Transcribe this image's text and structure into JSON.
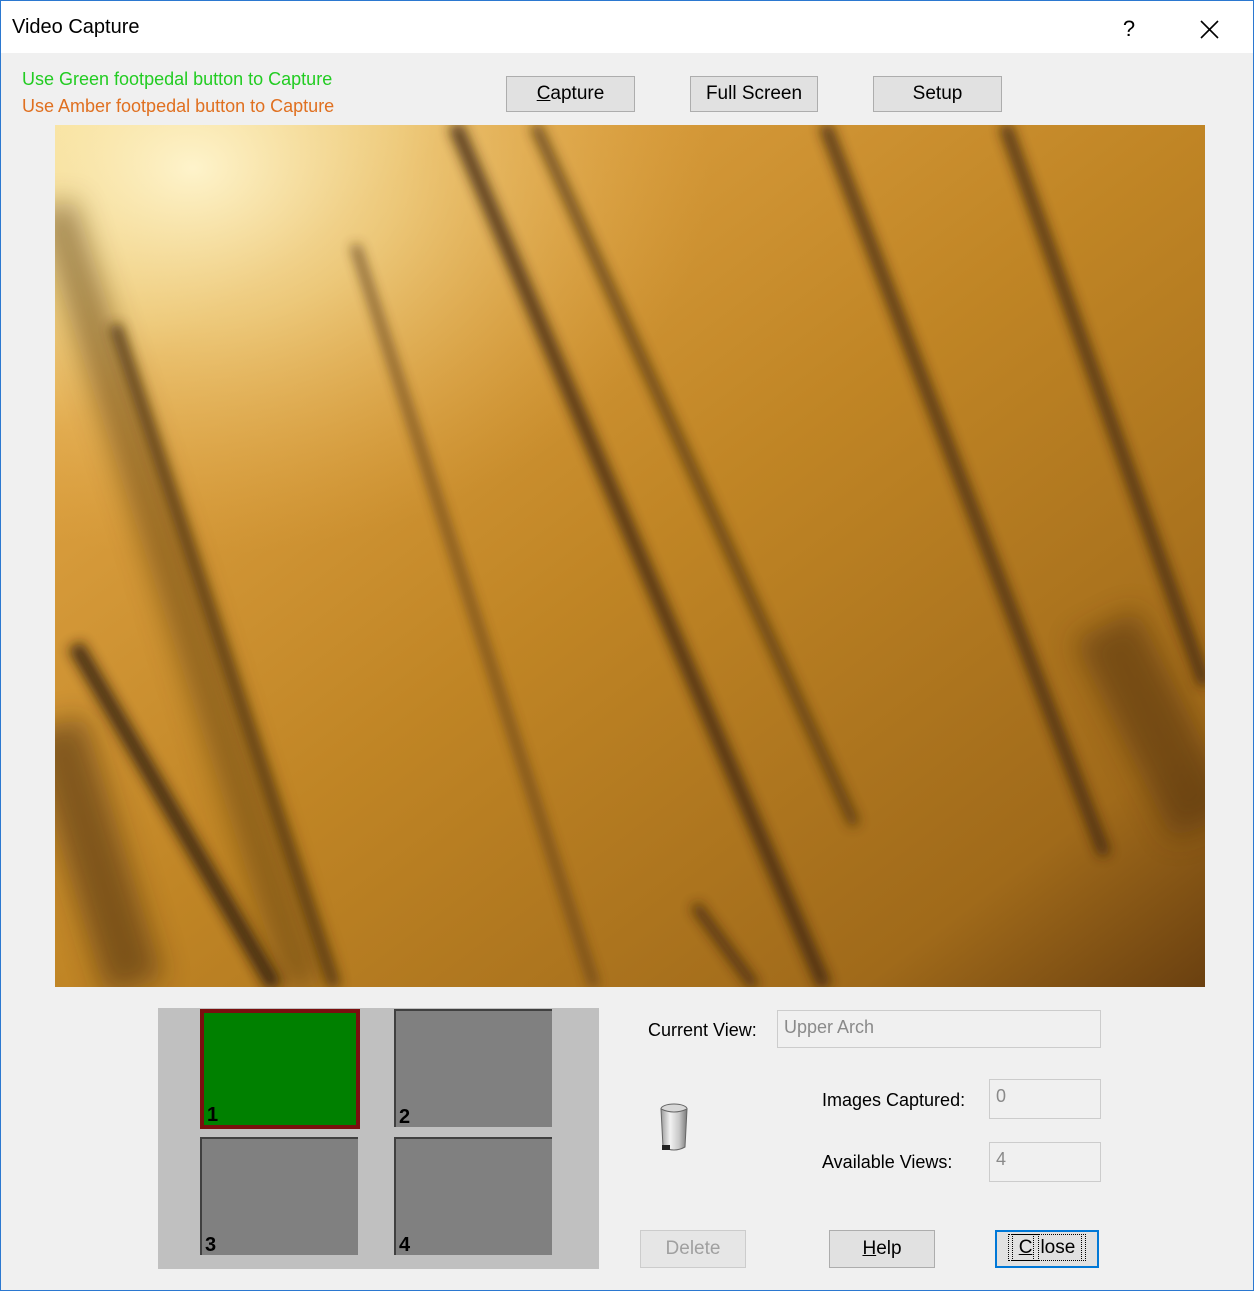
{
  "window": {
    "title": "Video Capture",
    "help_glyph": "?",
    "close_icon": "close-icon"
  },
  "hints": {
    "green": "Use Green footpedal button to Capture",
    "green_color": "#22cc22",
    "amber": "Use Amber footpedal button to Capture",
    "amber_color": "#e07020"
  },
  "toolbar": {
    "capture_prefix": "",
    "capture_accel": "C",
    "capture_rest": "apture",
    "fullscreen_label": "Full Screen",
    "setup_label": "Setup"
  },
  "thumbnails": [
    {
      "number": "1",
      "selected": true
    },
    {
      "number": "2",
      "selected": false
    },
    {
      "number": "3",
      "selected": false
    },
    {
      "number": "4",
      "selected": false
    }
  ],
  "info": {
    "current_view_label": "Current View:",
    "current_view_value": "Upper Arch",
    "images_captured_label": "Images Captured:",
    "images_captured_value": "0",
    "available_views_label": "Available Views:",
    "available_views_value": "4"
  },
  "bottom_buttons": {
    "delete_label": "Delete",
    "help_accel": "H",
    "help_rest": "elp",
    "close_accel": "C",
    "close_rest": "lose"
  },
  "icons": {
    "trash": "trash-can-icon"
  }
}
